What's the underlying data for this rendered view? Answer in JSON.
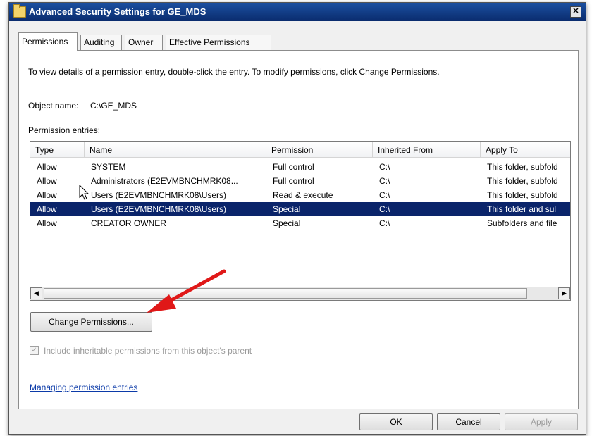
{
  "window": {
    "title": "Advanced Security Settings for GE_MDS",
    "close_glyph": "✕"
  },
  "tabs": [
    {
      "label": "Permissions",
      "active": true
    },
    {
      "label": "Auditing",
      "active": false
    },
    {
      "label": "Owner",
      "active": false
    },
    {
      "label": "Effective Permissions",
      "active": false
    }
  ],
  "panel": {
    "instructions": "To view details of a permission entry, double-click the entry. To modify permissions, click Change Permissions.",
    "object_name_label": "Object name:",
    "object_name_value": "C:\\GE_MDS",
    "entries_label": "Permission entries:"
  },
  "table": {
    "columns": [
      "Type",
      "Name",
      "Permission",
      "Inherited From",
      "Apply To"
    ],
    "rows": [
      {
        "type": "Allow",
        "name": "SYSTEM",
        "permission": "Full control",
        "inherited_from": "C:\\",
        "apply_to": "This folder, subfold",
        "selected": false
      },
      {
        "type": "Allow",
        "name": "Administrators (E2EVMBNCHMRK08...",
        "permission": "Full control",
        "inherited_from": "C:\\",
        "apply_to": "This folder, subfold",
        "selected": false
      },
      {
        "type": "Allow",
        "name": "Users (E2EVMBNCHMRK08\\Users)",
        "permission": "Read & execute",
        "inherited_from": "C:\\",
        "apply_to": "This folder, subfold",
        "selected": false
      },
      {
        "type": "Allow",
        "name": "Users (E2EVMBNCHMRK08\\Users)",
        "permission": "Special",
        "inherited_from": "C:\\",
        "apply_to": "This folder and sul",
        "selected": true
      },
      {
        "type": "Allow",
        "name": "CREATOR OWNER",
        "permission": "Special",
        "inherited_from": "C:\\",
        "apply_to": "Subfolders and file",
        "selected": false
      }
    ],
    "scroll_left_glyph": "◀",
    "scroll_right_glyph": "▶"
  },
  "buttons": {
    "change_permissions": "Change Permissions...",
    "ok": "OK",
    "cancel": "Cancel",
    "apply": "Apply"
  },
  "checkbox": {
    "label": "Include inheritable permissions from this object's parent",
    "checked": true,
    "enabled": false,
    "glyph": "✓"
  },
  "link": {
    "label": "Managing permission entries"
  },
  "colors": {
    "selection": "#0a246a",
    "annotation_arrow": "#e01818",
    "link": "#0b3aa8"
  },
  "icons": [
    "folder-icon",
    "close-icon",
    "cursor-icon",
    "annotation-arrow-icon"
  ]
}
